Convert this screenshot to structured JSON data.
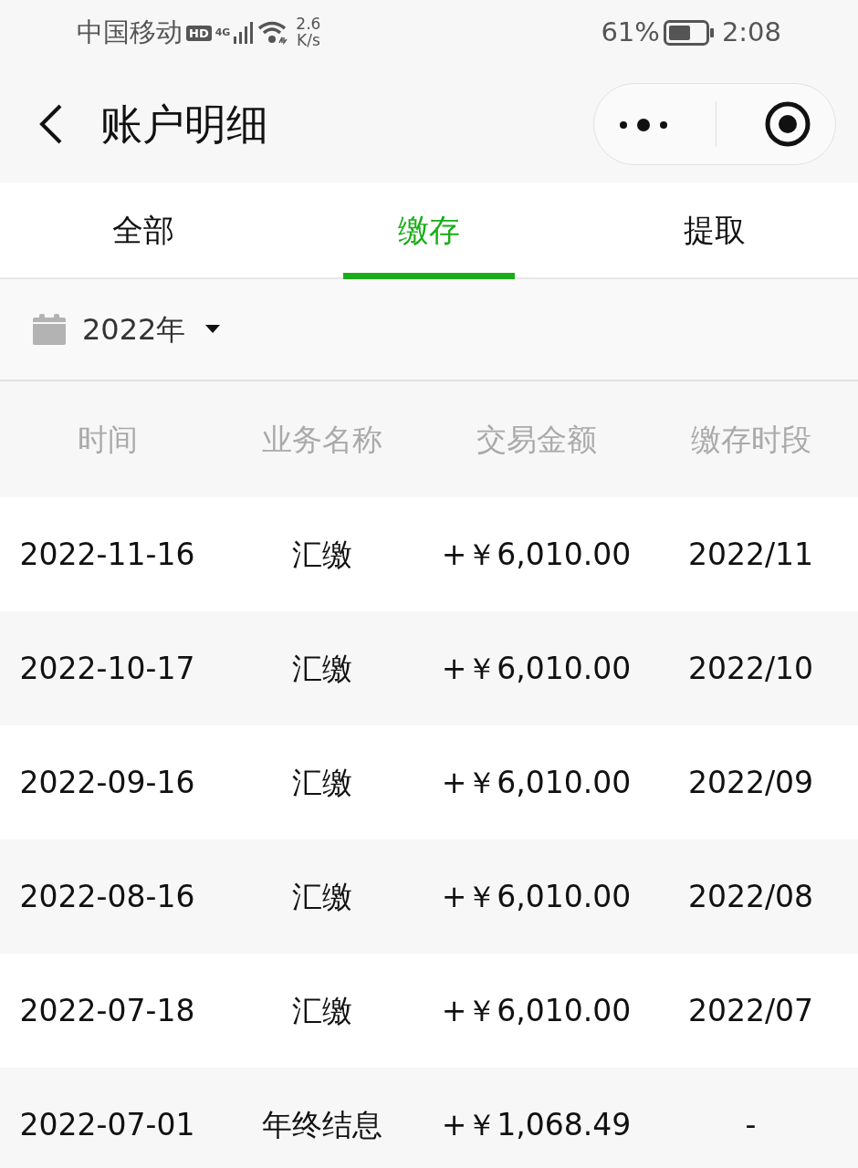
{
  "status_bar": {
    "carrier": "中国移动",
    "hd_badge": "HD",
    "network": "4G",
    "speed_value": "2.6",
    "speed_unit": "K/s",
    "battery_text": "61%",
    "time": "2:08"
  },
  "header": {
    "title": "账户明细"
  },
  "tabs": [
    {
      "label": "全部",
      "selected": false
    },
    {
      "label": "缴存",
      "selected": true
    },
    {
      "label": "提取",
      "selected": false
    }
  ],
  "filter": {
    "year": "2022年"
  },
  "table": {
    "columns": [
      "时间",
      "业务名称",
      "交易金额",
      "缴存时段"
    ],
    "rows": [
      [
        "2022-11-16",
        "汇缴",
        "+￥6,010.00",
        "2022/11"
      ],
      [
        "2022-10-17",
        "汇缴",
        "+￥6,010.00",
        "2022/10"
      ],
      [
        "2022-09-16",
        "汇缴",
        "+￥6,010.00",
        "2022/09"
      ],
      [
        "2022-08-16",
        "汇缴",
        "+￥6,010.00",
        "2022/08"
      ],
      [
        "2022-07-18",
        "汇缴",
        "+￥6,010.00",
        "2022/07"
      ],
      [
        "2022-07-01",
        "年终结息",
        "+￥1,068.49",
        "-"
      ]
    ]
  }
}
